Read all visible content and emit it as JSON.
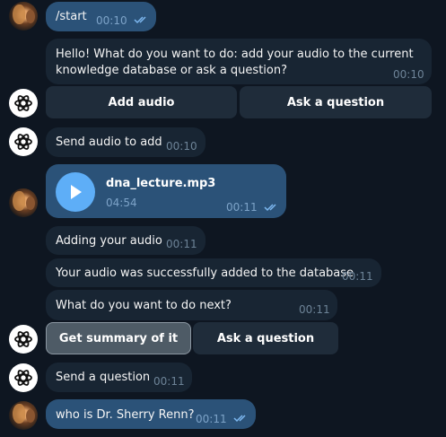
{
  "messages": {
    "m1": {
      "text": "/start",
      "time": "00:10"
    },
    "m2": {
      "line1": "Hello! What do you want to do: add your audio to the current",
      "line2": "knowledge database or ask a question?",
      "time": "00:10"
    },
    "kb1": {
      "btn1": "Add audio",
      "btn2": "Ask a question"
    },
    "m3": {
      "text": "Send audio to add",
      "time": "00:10"
    },
    "m4": {
      "filename": "dna_lecture.mp3",
      "duration": "04:54",
      "time": "00:11"
    },
    "m5": {
      "text": "Adding your audio",
      "time": "00:11"
    },
    "m6": {
      "text": "Your audio was successfully added to the database",
      "time": "00:11"
    },
    "m7": {
      "text": "What do you want to do next?",
      "time": "00:11"
    },
    "kb2": {
      "btn1": "Get summary of it",
      "btn2": "Ask a question"
    },
    "m8": {
      "text": "Send a question",
      "time": "00:11"
    },
    "m9": {
      "text": "who is Dr. Sherry Renn?",
      "time": "00:11"
    }
  },
  "icons": {
    "user_avatar": "user-avatar-photo",
    "bot_avatar": "openai-logo-icon",
    "read_status": "double-check-icon",
    "audio": "play-icon"
  },
  "colors": {
    "background": "#0e1621",
    "incoming_bubble": "#182533",
    "outgoing_bubble": "#2b5278",
    "accent": "#5eaef7",
    "check": "#7db8f0"
  }
}
